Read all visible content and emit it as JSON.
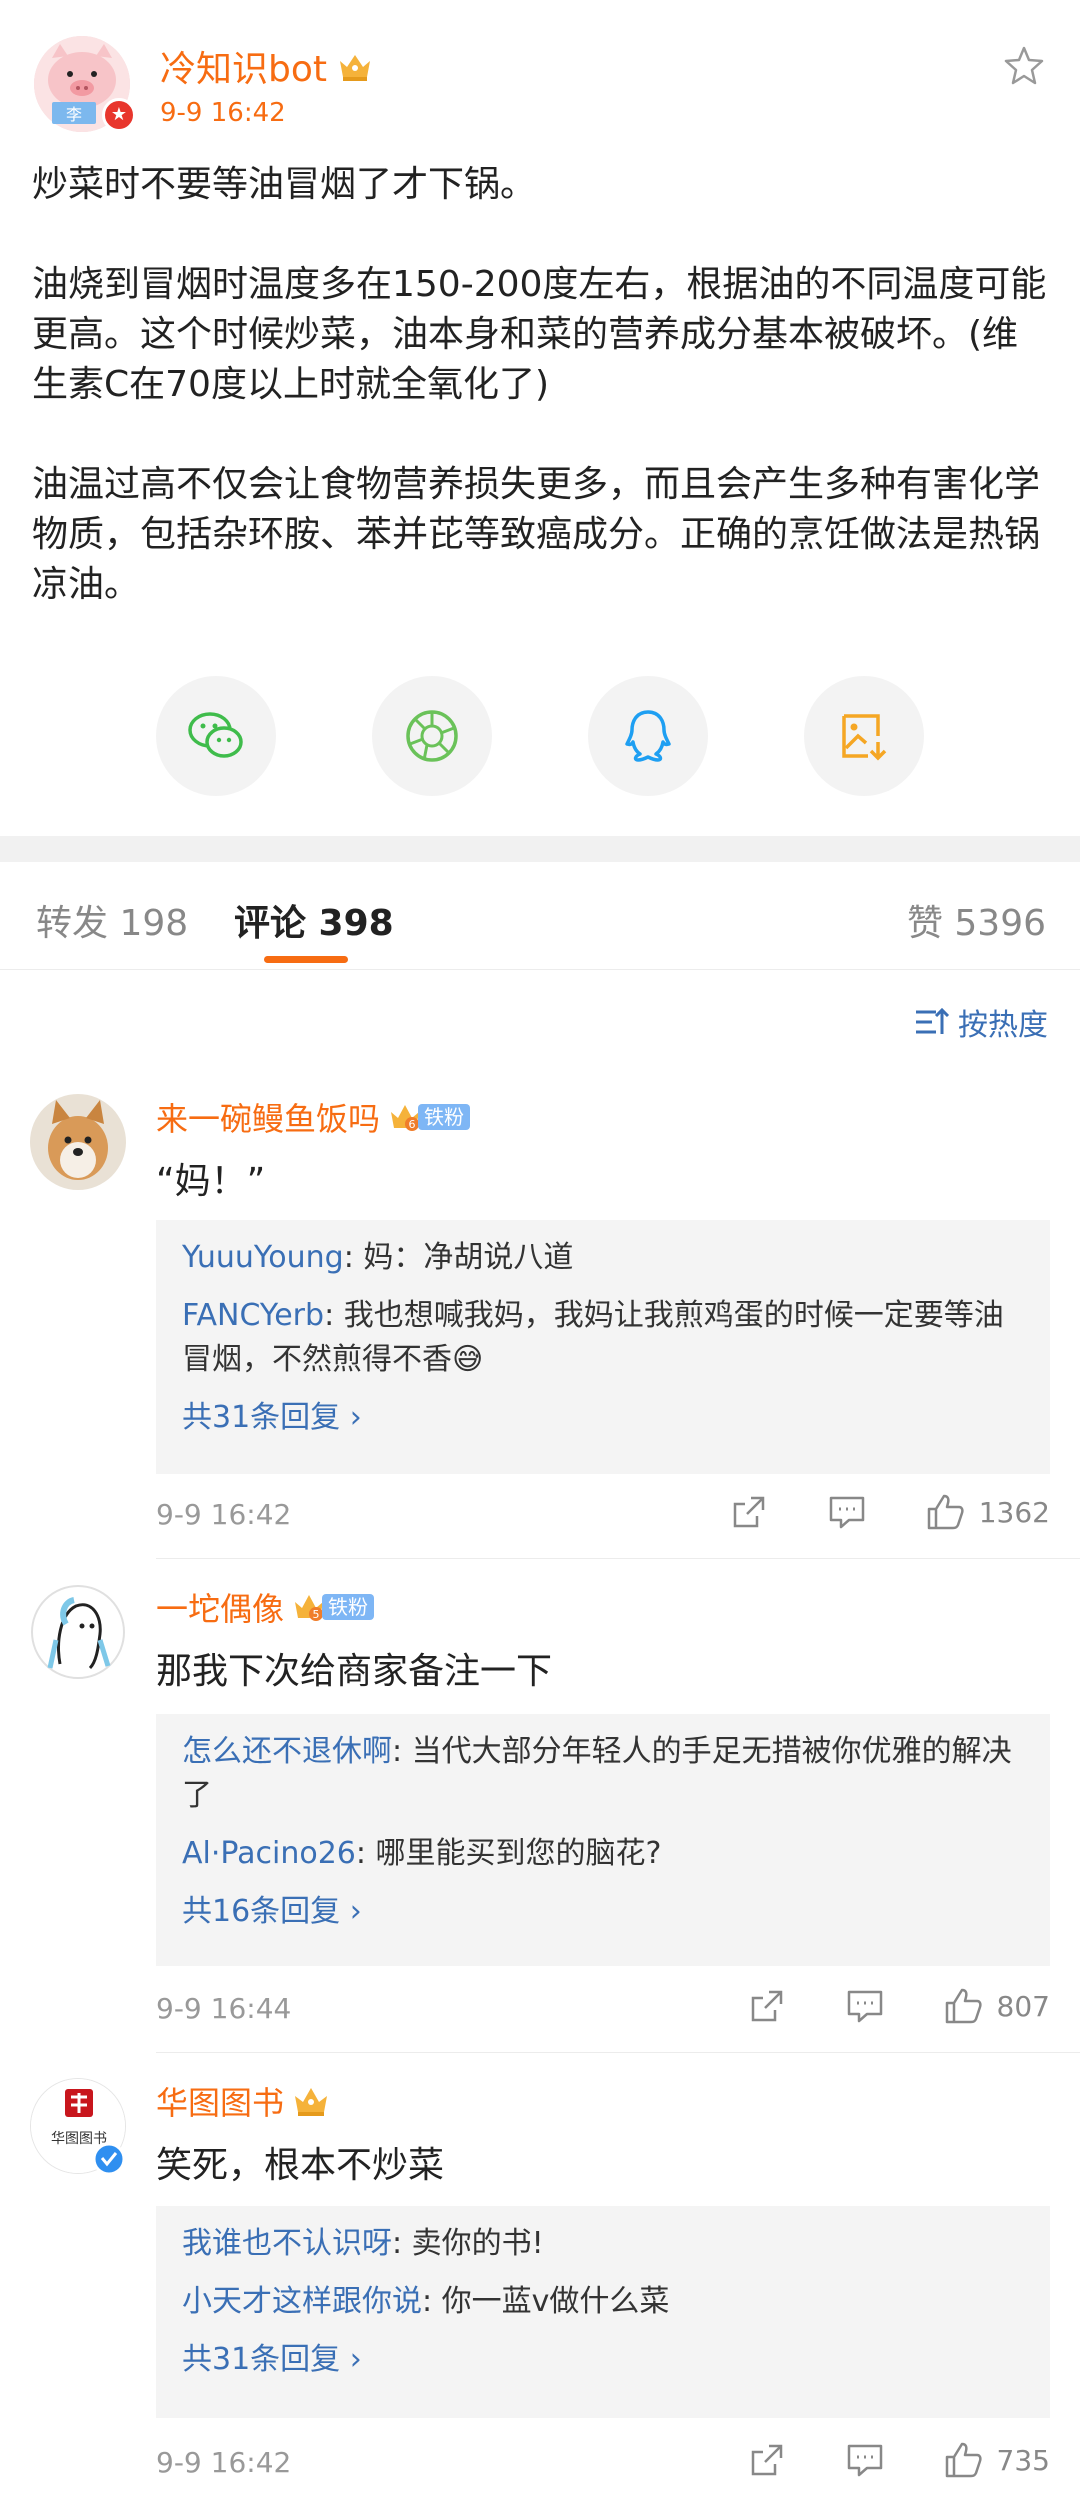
{
  "post": {
    "author": "冷知识bot",
    "time": "9-9 16:42",
    "paragraphs": [
      "炒菜时不要等油冒烟了才下锅。",
      "油烧到冒烟时温度多在150-200度左右，根据油的不同温度可能更高。这个时候炒菜，油本身和菜的营养成分基本被破坏。(维生素C在70度以上时就全氧化了)",
      "油温过高不仅会让食物营养损失更多，而且会产生多种有害化学物质，包括杂环胺、苯并芘等致癌成分。正确的烹饪做法是热锅凉油。"
    ],
    "avatar_text": "李"
  },
  "share": {
    "icons": [
      "wechat-icon",
      "moments-icon",
      "qq-icon",
      "save-image-icon"
    ],
    "colors": {
      "wechat": "#3fbc4b",
      "moments": "#6ac259",
      "qq": "#1e9ff2",
      "save": "#f5a623"
    }
  },
  "tabs": {
    "repost": "转发 198",
    "comments": "评论 398",
    "likes": "赞 5396"
  },
  "sort": {
    "label": "按热度"
  },
  "fan_tag": "铁粉",
  "comments": [
    {
      "name": "来一碗鳗鱼饭吗",
      "level": "6",
      "text": "“妈！”",
      "replies": [
        {
          "user": "YuuuYoung",
          "text": ": 妈：净胡说八道"
        },
        {
          "user": "FANCYerb",
          "text": ": 我也想喊我妈，我妈让我煎鸡蛋的时候一定要等油冒烟，不然煎得不香"
        }
      ],
      "more": "共31条回复",
      "time": "9-9 16:42",
      "likes": "1362"
    },
    {
      "name": "一坨偶像",
      "level": "5",
      "text": "那我下次给商家备注一下",
      "replies": [
        {
          "user": "怎么还不退休啊",
          "text": ": 当代大部分年轻人的手足无措被你优雅的解决了"
        },
        {
          "user": "Al·Pacino26",
          "text": ": 哪里能买到您的脑花?"
        }
      ],
      "more": "共16条回复",
      "time": "9-9 16:44",
      "likes": "807"
    },
    {
      "name": "华图图书",
      "text": "笑死，根本不炒菜",
      "avatar_text": "华图图书",
      "replies": [
        {
          "user": "我谁也不认识呀",
          "text": ": 卖你的书!"
        },
        {
          "user": "小天才这样跟你说",
          "text": ": 你一蓝v做什么菜"
        }
      ],
      "more": "共31条回复",
      "time": "9-9 16:42",
      "likes": "735"
    }
  ],
  "colors": {
    "accent": "#f76c12",
    "link": "#3a6fb5",
    "reply_bg": "#f4f4f4"
  }
}
